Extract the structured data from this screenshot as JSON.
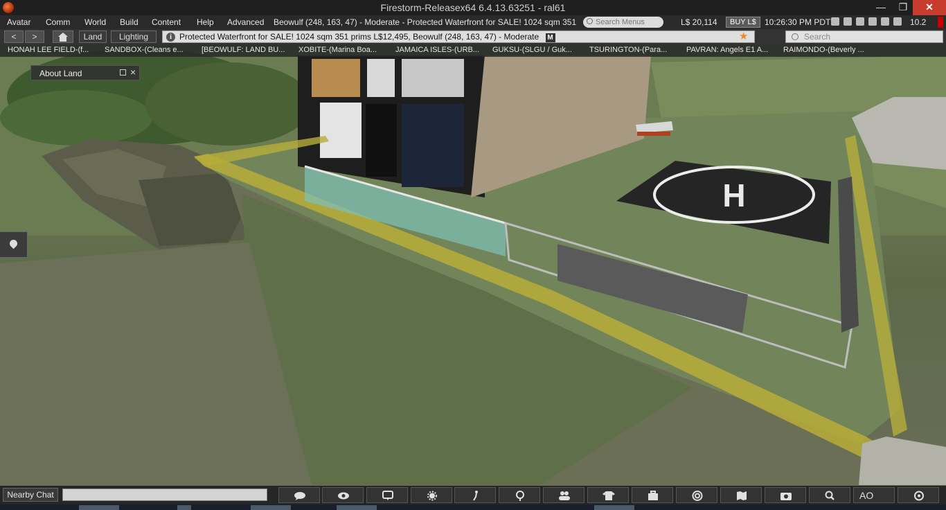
{
  "window": {
    "title": "Firestorm-Releasex64 6.4.13.63251 - ral61"
  },
  "menubar": {
    "items": [
      "Avatar",
      "Comm",
      "World",
      "Build",
      "Content",
      "Help",
      "Advanced"
    ],
    "location_status": "Beowulf (248, 163, 47) - Moderate - Protected Waterfront for SALE! 1024 sqm 351",
    "search_placeholder": "Search Menus",
    "balance": "L$ 20,114",
    "buy_label": "BUY L$",
    "clock": "10:26:30 PM PDT",
    "fps": "10.2",
    "status_icons": [
      "media-icon",
      "voice-icon",
      "network-icon",
      "music-icon",
      "film-icon",
      "volume-icon"
    ]
  },
  "navbar": {
    "back_label": "<",
    "forward_label": ">",
    "land_label": "Land",
    "lighting_label": "Lighting",
    "location_text": "Protected Waterfront for SALE! 1024 sqm 351 prims L$12,495, Beowulf (248, 163, 47) - Moderate",
    "maturity_badge": "M",
    "search_placeholder": "Search"
  },
  "favorites": [
    "HONAH LEE FIELD-(f...",
    "SANDBOX-(Cleans e...",
    "[BEOWULF: LAND BU...",
    "XOBITE-(Marina Boa...",
    "JAMAICA ISLES-(URB...",
    "GUKSU-(SLGU / Guk...",
    "TSURINGTON-(Para...",
    "PAVRAN: Angels E1 A...",
    "RAIMONDO-(Beverly ..."
  ],
  "floater": {
    "title": "About Land"
  },
  "chat": {
    "label": "Nearby Chat",
    "input_value": ""
  },
  "toolbar": {
    "buttons": [
      "chat-icon",
      "eye-icon",
      "im-icon",
      "gesture-icon",
      "walk-icon",
      "places-icon",
      "people-icon",
      "appearance-icon",
      "inventory-icon",
      "radar-icon",
      "map-icon",
      "snapshot-icon",
      "search-icon",
      "ao-button",
      "camera-icon"
    ],
    "ao_label": "AO"
  },
  "colors": {
    "close_button": "#c83c2e",
    "favorite_star": "#f08a1a",
    "fps_indicator": "#c40000"
  }
}
